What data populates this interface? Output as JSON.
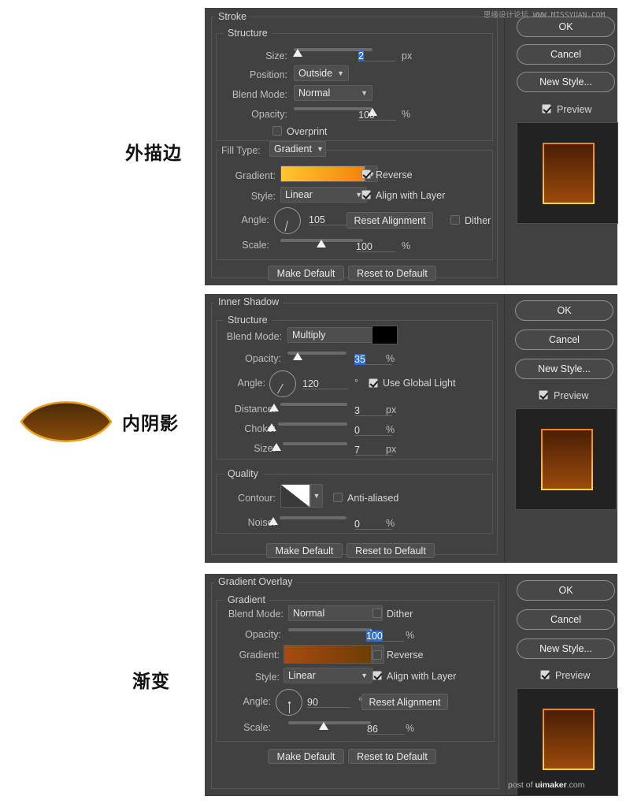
{
  "annotations": [
    {
      "text": "外描边",
      "meaning": "outer-stroke"
    },
    {
      "text": "内阴影",
      "meaning": "inner-shadow"
    },
    {
      "text": "渐变",
      "meaning": "gradient"
    }
  ],
  "watermarks": {
    "top": "思缘设计论坛 WWW.MISSYUAN.COM",
    "bottom_prefix": "post of ",
    "bottom_brand": "uimaker",
    "bottom_suffix": ".com"
  },
  "colors": {
    "dialog_bg": "#414141",
    "field_bg": "#4e4e4e",
    "highlight_blue": "#2c6fd1",
    "stroke_gradient_start": "#ffc82d",
    "stroke_gradient_end": "#f5820a",
    "overlay_gradient_start": "#a84a10",
    "overlay_gradient_end": "#6e3d06",
    "shadow_color": "#000000",
    "preview_bg": "#222222"
  },
  "buttons": {
    "ok": "OK",
    "cancel": "Cancel",
    "new_style": "New Style...",
    "preview": "Preview",
    "make_default": "Make Default",
    "reset_to_default": "Reset to Default",
    "reset_alignment": "Reset Alignment"
  },
  "stroke_panel": {
    "title": "Stroke",
    "structure_title": "Structure",
    "size": {
      "label": "Size:",
      "value": "2",
      "unit": "px",
      "slider_pct": 6,
      "highlighted": true
    },
    "position": {
      "label": "Position:",
      "value": "Outside"
    },
    "blend_mode": {
      "label": "Blend Mode:",
      "value": "Normal"
    },
    "opacity": {
      "label": "Opacity:",
      "value": "100",
      "unit": "%",
      "slider_pct": 100
    },
    "overprint": {
      "label": "Overprint",
      "checked": false
    },
    "fill_type": {
      "label": "Fill Type:",
      "value": "Gradient"
    },
    "gradient": {
      "label": "Gradient:"
    },
    "reverse": {
      "label": "Reverse",
      "checked": true
    },
    "style": {
      "label": "Style:",
      "value": "Linear"
    },
    "align_with_layer": {
      "label": "Align with Layer",
      "checked": true
    },
    "angle": {
      "label": "Angle:",
      "value": "105",
      "unit": "°"
    },
    "dither": {
      "label": "Dither",
      "checked": false
    },
    "scale": {
      "label": "Scale:",
      "value": "100",
      "unit": "%",
      "slider_pct": 52
    }
  },
  "inner_shadow_panel": {
    "title": "Inner Shadow",
    "structure_title": "Structure",
    "blend_mode": {
      "label": "Blend Mode:",
      "value": "Multiply"
    },
    "opacity": {
      "label": "Opacity:",
      "value": "35",
      "unit": "%",
      "slider_pct": 35,
      "highlighted": true
    },
    "angle": {
      "label": "Angle:",
      "value": "120",
      "unit": "°"
    },
    "use_global_light": {
      "label": "Use Global Light",
      "checked": true
    },
    "distance": {
      "label": "Distance:",
      "value": "3",
      "unit": "px",
      "slider_pct": 3
    },
    "choke": {
      "label": "Choke:",
      "value": "0",
      "unit": "%",
      "slider_pct": 0
    },
    "size": {
      "label": "Size:",
      "value": "7",
      "unit": "px",
      "slider_pct": 5
    },
    "quality_title": "Quality",
    "contour": {
      "label": "Contour:"
    },
    "anti_aliased": {
      "label": "Anti-aliased",
      "checked": false
    },
    "noise": {
      "label": "Noise:",
      "value": "0",
      "unit": "%",
      "slider_pct": 0
    }
  },
  "gradient_overlay_panel": {
    "title": "Gradient Overlay",
    "gradient_title": "Gradient",
    "blend_mode": {
      "label": "Blend Mode:",
      "value": "Normal"
    },
    "dither": {
      "label": "Dither",
      "checked": false
    },
    "opacity": {
      "label": "Opacity:",
      "value": "100",
      "unit": "%",
      "slider_pct": 100,
      "highlighted": true
    },
    "gradient": {
      "label": "Gradient:"
    },
    "reverse": {
      "label": "Reverse",
      "checked": false
    },
    "style": {
      "label": "Style:",
      "value": "Linear"
    },
    "align_with_layer": {
      "label": "Align with Layer",
      "checked": true
    },
    "angle": {
      "label": "Angle:",
      "value": "90",
      "unit": "°"
    },
    "scale": {
      "label": "Scale:",
      "value": "86",
      "unit": "%",
      "slider_pct": 47
    }
  }
}
